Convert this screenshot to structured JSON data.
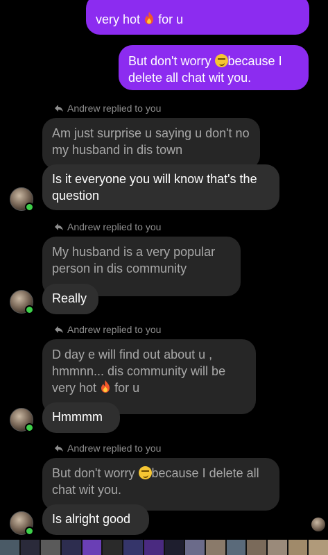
{
  "messages": {
    "sent_1_line1": "very hot",
    "sent_1_line1b": "for u",
    "sent_2_part1": "But don't worry",
    "sent_2_part1b": "because I",
    "sent_2_line2": "delete all chat wit you.",
    "reply_label": "Andrew replied to you",
    "quote_1": "Am just surprise u saying u don't no my husband in dis town",
    "recv_1": "Is it everyone you will know that's the question",
    "quote_2": "My husband is a very popular person in dis community",
    "recv_2": "Really",
    "quote_3_line1": "D day e will find out about u , hmmnn... dis community will be",
    "quote_3_line2a": "very hot",
    "quote_3_line2b": "for u",
    "recv_3": "Hmmmm",
    "quote_4_a": "But don't worry",
    "quote_4_b": "because I delete all chat wit you.",
    "recv_4": "Is alright good"
  },
  "icons": {
    "reply": "reply-arrow-icon",
    "fire": "fire-emoji-icon",
    "smirk": "smirk-emoji-icon",
    "avatar": "avatar"
  },
  "colors": {
    "sent_bubble": "#8c2cf0",
    "received_bubble": "#2f2f2f",
    "quoted_bubble": "#262626",
    "online_dot": "#3ecf4a"
  }
}
